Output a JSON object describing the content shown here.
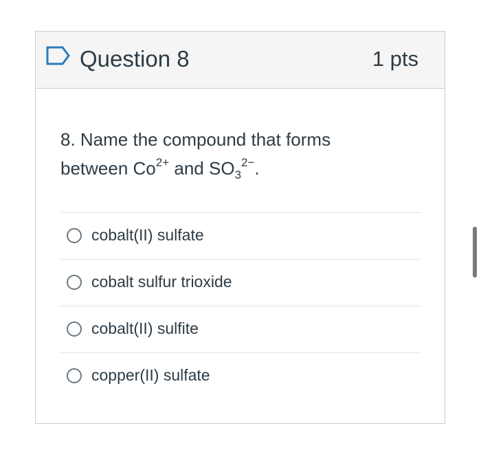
{
  "header": {
    "title": "Question 8",
    "points": "1 pts"
  },
  "question": {
    "text_line1": "8. Name the compound that forms",
    "text_line2_prefix": "between Co",
    "cation_charge": "2+",
    "middle": " and SO",
    "anion_subscript": "3",
    "anion_charge": "2−",
    "suffix": "."
  },
  "answers": [
    {
      "label": "cobalt(II) sulfate"
    },
    {
      "label": "cobalt sulfur trioxide"
    },
    {
      "label": "cobalt(II) sulfite"
    },
    {
      "label": "copper(II) sulfate"
    }
  ],
  "icons": {
    "flag": "bookmark-flag-icon"
  }
}
